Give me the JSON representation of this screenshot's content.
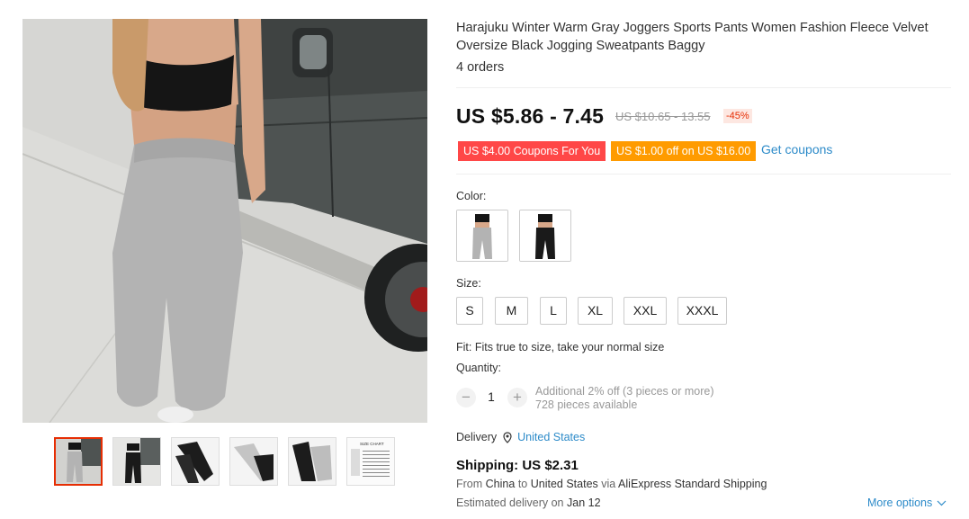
{
  "product": {
    "title": "Harajuku Winter Warm Gray Joggers Sports Pants Women Fashion Fleece Velvet Oversize Black Jogging Sweatpants Baggy",
    "orders": "4 orders"
  },
  "price": {
    "current": "US $5.86 - 7.45",
    "original": "US $10.65 - 13.55",
    "discount": "-45%"
  },
  "coupons": {
    "coupon1": "US $4.00 Coupons For You",
    "coupon2": "US $1.00 off on US $16.00",
    "get_label": "Get coupons"
  },
  "color": {
    "label": "Color:",
    "options": [
      "gray",
      "black"
    ],
    "selected": 0
  },
  "size": {
    "label": "Size:",
    "options": [
      "S",
      "M",
      "L",
      "XL",
      "XXL",
      "XXXL"
    ]
  },
  "fit": "Fit: Fits true to size, take your normal size",
  "quantity": {
    "label": "Quantity:",
    "minus": "−",
    "value": "1",
    "plus": "+",
    "note": "Additional 2% off (3 pieces or more)",
    "available": "728 pieces available"
  },
  "delivery": {
    "label": "Delivery",
    "country": "United States"
  },
  "shipping": {
    "title": "Shipping: US $2.31",
    "from_prefix": "From",
    "from_country": "China",
    "to_word": "to",
    "to_country": "United States",
    "via_prefix": "via",
    "method": "AliExpress Standard Shipping",
    "eta_prefix": "Estimated delivery on",
    "eta_date": "Jan 12",
    "more": "More options"
  },
  "gallery": {
    "thumb_count": 6,
    "selected": 0,
    "size_chart_text": "SIZE CHART"
  },
  "colors": {
    "accent_red": "#ff4747",
    "accent_orange": "#ff9b00",
    "link_blue": "#2d8bc9",
    "selected_border": "#e62e04"
  }
}
